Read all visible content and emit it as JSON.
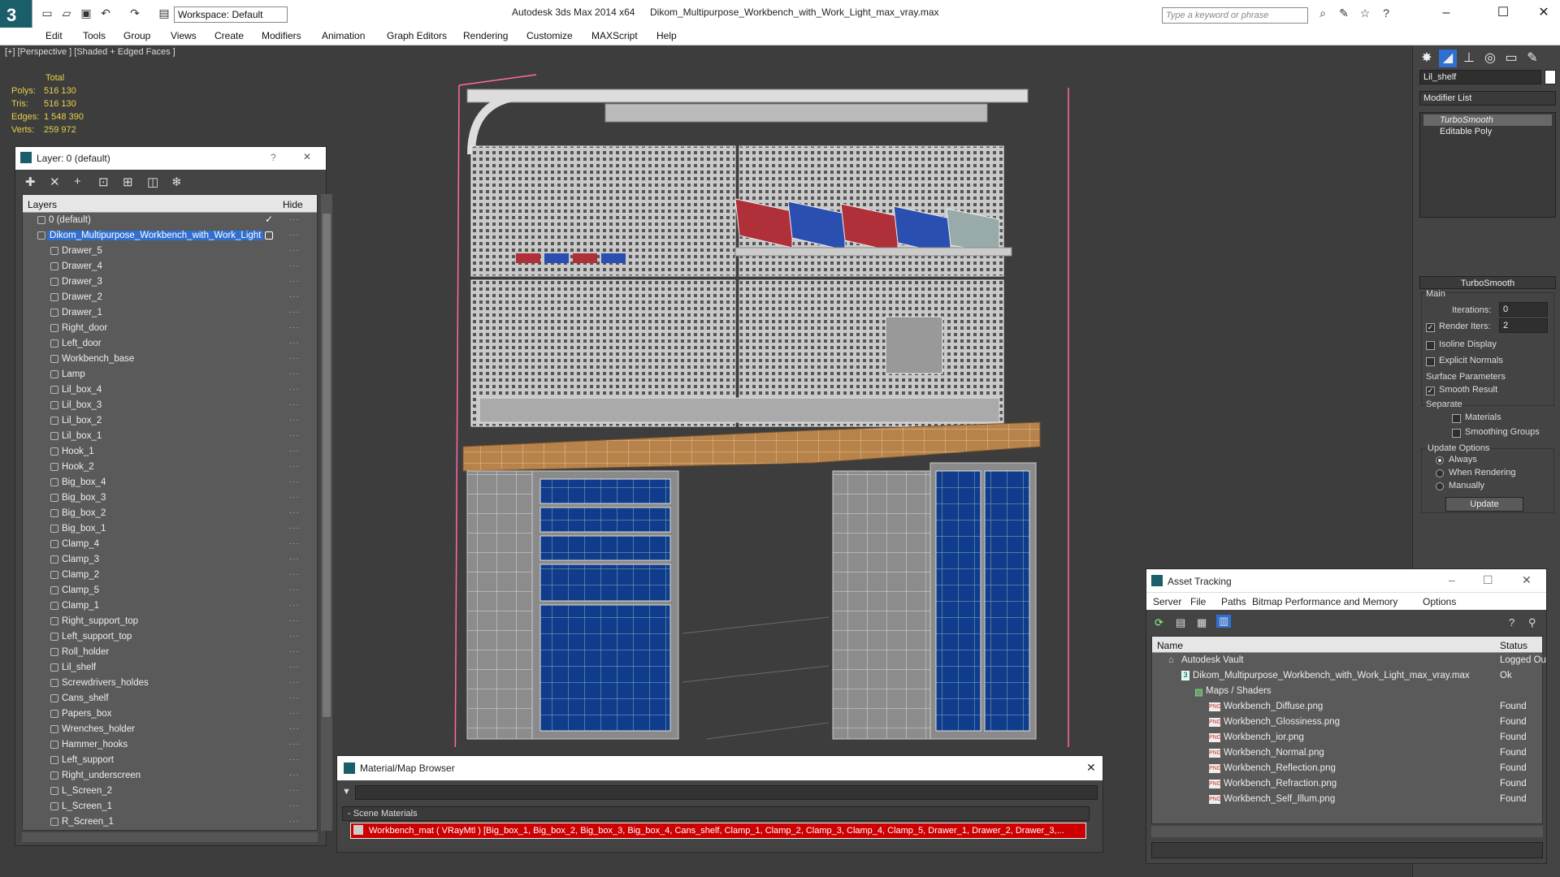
{
  "app": {
    "title": "Autodesk 3ds Max  2014 x64",
    "filename": "Dikom_Multipurpose_Workbench_with_Work_Light_max_vray.max",
    "workspace": "Workspace: Default",
    "search_placeholder": "Type a keyword or phrase"
  },
  "menu": [
    "Edit",
    "Tools",
    "Group",
    "Views",
    "Create",
    "Modifiers",
    "Animation",
    "Graph Editors",
    "Rendering",
    "Customize",
    "MAXScript",
    "Help"
  ],
  "viewport": {
    "label": "[+] [Perspective ] [Shaded + Edged Faces ]",
    "stats": {
      "header": "Total",
      "polys_label": "Polys:",
      "polys": "516 130",
      "tris_label": "Tris:",
      "tris": "516 130",
      "edges_label": "Edges:",
      "edges": "1 548 390",
      "verts_label": "Verts:",
      "verts": "259 972"
    }
  },
  "layer_panel": {
    "title": "Layer: 0 (default)",
    "help": "?",
    "close": "✕",
    "col_layers": "Layers",
    "col_hide": "Hide",
    "default_layer": "0 (default)",
    "selected_layer": "Dikom_Multipurpose_Workbench_with_Work_Light",
    "items": [
      "Drawer_5",
      "Drawer_4",
      "Drawer_3",
      "Drawer_2",
      "Drawer_1",
      "Right_door",
      "Left_door",
      "Workbench_base",
      "Lamp",
      "Lil_box_4",
      "Lil_box_3",
      "Lil_box_2",
      "Lil_box_1",
      "Hook_1",
      "Hook_2",
      "Big_box_4",
      "Big_box_3",
      "Big_box_2",
      "Big_box_1",
      "Clamp_4",
      "Clamp_3",
      "Clamp_2",
      "Clamp_5",
      "Clamp_1",
      "Right_support_top",
      "Left_support_top",
      "Roll_holder",
      "Lil_shelf",
      "Screwdrivers_holdes",
      "Cans_shelf",
      "Papers_box",
      "Wrenches_holder",
      "Hammer_hooks",
      "Left_support",
      "Right_underscreen",
      "L_Screen_2",
      "L_Screen_1",
      "R_Screen_1"
    ]
  },
  "command_panel": {
    "object_name": "Lil_shelf",
    "modifier_list": "Modifier List",
    "stack": [
      "TurboSmooth",
      "Editable Poly"
    ],
    "rollout_title": "TurboSmooth",
    "main_label": "Main",
    "iterations_label": "Iterations:",
    "iterations": "0",
    "render_iters_label": "Render Iters:",
    "render_iters": "2",
    "isoline": "Isoline Display",
    "explicit_normals": "Explicit Normals",
    "surface_params": "Surface Parameters",
    "smooth_result": "Smooth Result",
    "separate": "Separate",
    "materials": "Materials",
    "smoothing_groups": "Smoothing Groups",
    "update_options": "Update Options",
    "always": "Always",
    "when_rendering": "When Rendering",
    "manually": "Manually",
    "update_button": "Update"
  },
  "material_browser": {
    "title": "Material/Map Browser",
    "close": "✕",
    "section": "- Scene Materials",
    "item": "Workbench_mat  ( VRayMtl ) [Big_box_1, Big_box_2, Big_box_3, Big_box_4, Cans_shelf, Clamp_1, Clamp_2, Clamp_3, Clamp_4, Clamp_5, Drawer_1, Drawer_2, Drawer_3,..."
  },
  "asset_tracking": {
    "title": "Asset Tracking",
    "menu": [
      "Server",
      "File",
      "Paths",
      "Bitmap Performance and Memory",
      "Options"
    ],
    "col_name": "Name",
    "col_status": "Status",
    "vault": "Autodesk Vault",
    "vault_status": "Logged Ou",
    "file": "Dikom_Multipurpose_Workbench_with_Work_Light_max_vray.max",
    "file_status": "Ok",
    "maps": "Maps / Shaders",
    "textures": [
      {
        "name": "Workbench_Diffuse.png",
        "status": "Found"
      },
      {
        "name": "Workbench_Glossiness.png",
        "status": "Found"
      },
      {
        "name": "Workbench_ior.png",
        "status": "Found"
      },
      {
        "name": "Workbench_Normal.png",
        "status": "Found"
      },
      {
        "name": "Workbench_Reflection.png",
        "status": "Found"
      },
      {
        "name": "Workbench_Refraction.png",
        "status": "Found"
      },
      {
        "name": "Workbench_Self_Illum.png",
        "status": "Found"
      }
    ]
  },
  "colors": {
    "selection": "#2f6fd0",
    "stats": "#e8d14a",
    "wood": "#b8834a",
    "drawer": "#0f3d8c"
  }
}
